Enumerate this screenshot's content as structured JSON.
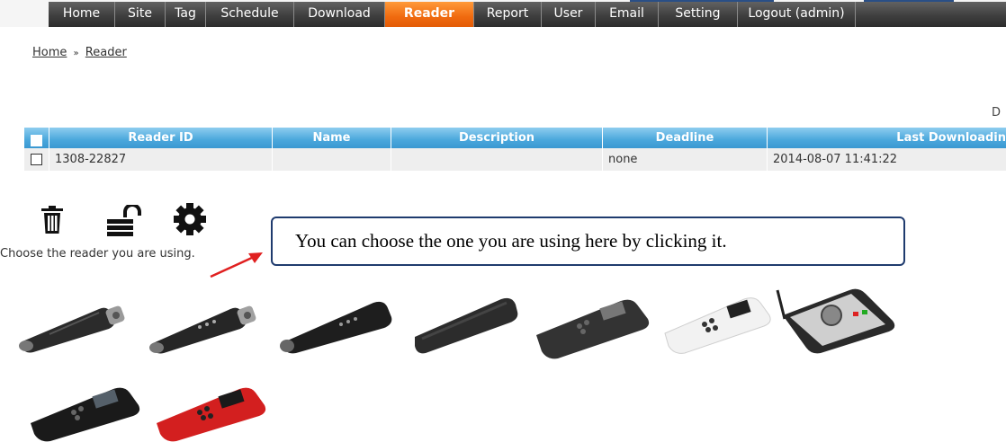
{
  "nav": {
    "items": [
      {
        "label": "Home",
        "active": false
      },
      {
        "label": "Site",
        "active": false
      },
      {
        "label": "Tag",
        "active": false
      },
      {
        "label": "Schedule",
        "active": false
      },
      {
        "label": "Download",
        "active": false
      },
      {
        "label": "Reader",
        "active": true
      },
      {
        "label": "Report",
        "active": false
      },
      {
        "label": "User",
        "active": false
      },
      {
        "label": "Email",
        "active": false
      },
      {
        "label": "Setting",
        "active": false
      },
      {
        "label": "Logout (admin)",
        "active": false
      }
    ],
    "active_color": "#f07a1a"
  },
  "breadcrumb": {
    "home": "Home",
    "separator": "»",
    "current": "Reader"
  },
  "corner_letter": "D",
  "table": {
    "headers": [
      "Reader ID",
      "Name",
      "Description",
      "Deadline",
      "Last Downloadin"
    ],
    "rows": [
      {
        "reader_id": "1308-22827",
        "name": "",
        "description": "",
        "deadline": "none",
        "last_download": "2014-08-07 11:41:22"
      }
    ],
    "header_color": "#4aa7dc"
  },
  "actions": {
    "icons": [
      "trash-icon",
      "unlock-icon",
      "gear-icon"
    ]
  },
  "choose_text": "Choose the reader you are using.",
  "callout": {
    "text": "You can choose the one you are using here by clicking it.",
    "arrow_color": "#e02020"
  },
  "readers": [
    {
      "icon": "reader-probe-1-icon"
    },
    {
      "icon": "reader-probe-2-icon"
    },
    {
      "icon": "reader-probe-3-icon"
    },
    {
      "icon": "reader-stick-icon"
    },
    {
      "icon": "reader-handheld-dark-icon"
    },
    {
      "icon": "reader-handheld-white-icon"
    },
    {
      "icon": "reader-base-station-icon"
    },
    {
      "icon": "reader-handheld-black-icon"
    },
    {
      "icon": "reader-handheld-red-icon"
    }
  ]
}
